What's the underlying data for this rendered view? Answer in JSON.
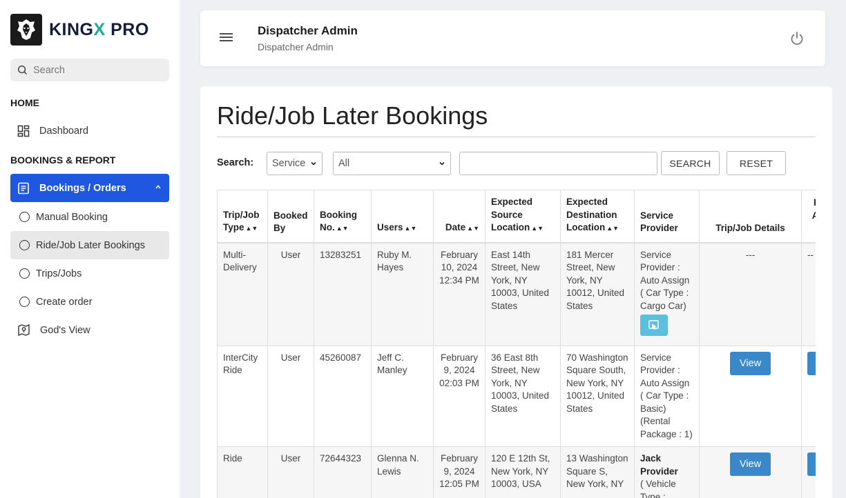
{
  "brand": {
    "name_a": "KING",
    "name_x": "X",
    "name_b": " PRO"
  },
  "sidebar": {
    "search_placeholder": "Search",
    "home_label": "HOME",
    "dashboard_label": "Dashboard",
    "bookings_section_label": "BOOKINGS & REPORT",
    "bookings_orders_label": "Bookings / Orders",
    "sub_items": [
      {
        "label": "Manual Booking"
      },
      {
        "label": "Ride/Job Later Bookings"
      },
      {
        "label": "Trips/Jobs"
      },
      {
        "label": "Create order"
      }
    ],
    "gods_view_label": "God's View"
  },
  "header": {
    "title": "Dispatcher Admin",
    "subtitle": "Dispatcher Admin"
  },
  "main": {
    "page_title": "Ride/Job Later Bookings",
    "search_label": "Search:",
    "select_service": "Service",
    "select_all": "All",
    "search_button": "SEARCH",
    "reset_button": "RESET"
  },
  "table": {
    "headers": {
      "trip_type_a": "Trip/Job",
      "trip_type_b": "Type",
      "booked_by_a": "Booked",
      "booked_by_b": "By",
      "booking_no_a": "Booking",
      "booking_no_b": "No.",
      "users": "Users",
      "date": "Date",
      "src_a": "Expected",
      "src_b": "Source",
      "src_c": "Location",
      "dst_a": "Expected",
      "dst_b": "Destination",
      "dst_c": "Location",
      "sp_a": "Service",
      "sp_b": "Provider",
      "trip_details": "Trip/Job Details",
      "extra_a": "E",
      "extra_b": "Al",
      "extra_c": "I"
    },
    "rows": [
      {
        "type": "Multi-Delivery",
        "booked_by": "User",
        "booking_no": "13283251",
        "user": "Ruby M. Hayes",
        "date": "February 10, 2024 12:34 PM",
        "source": "East 14th Street, New York, NY 10003, United States",
        "destination": "181 Mercer Street, New York, NY 10012, United States",
        "provider": "Service Provider : Auto Assign ( Car Type : Cargo Car)",
        "details": "---",
        "extra": "--"
      },
      {
        "type": "InterCity Ride",
        "booked_by": "User",
        "booking_no": "45260087",
        "user": "Jeff C. Manley",
        "date": "February 9, 2024 02:03 PM",
        "source": "36 East 8th Street, New York, NY 10003, United States",
        "destination": "70 Washington Square South, New York, NY 10012, United States",
        "provider": "Service Provider : Auto Assign ( Car Type : Basic) (Rental Package : 1)",
        "details_button": "View"
      },
      {
        "type": "Ride",
        "booked_by": "User",
        "booking_no": "72644323",
        "user": "Glenna N. Lewis",
        "date": "February 9, 2024 12:05 PM",
        "source": "120 E 12th St, New York, NY 10003, USA",
        "destination": "13 Washington Square S, New York, NY",
        "provider_name": "Jack Provider",
        "provider_rest": "( Vehicle Type :",
        "details_button": "View"
      }
    ]
  }
}
